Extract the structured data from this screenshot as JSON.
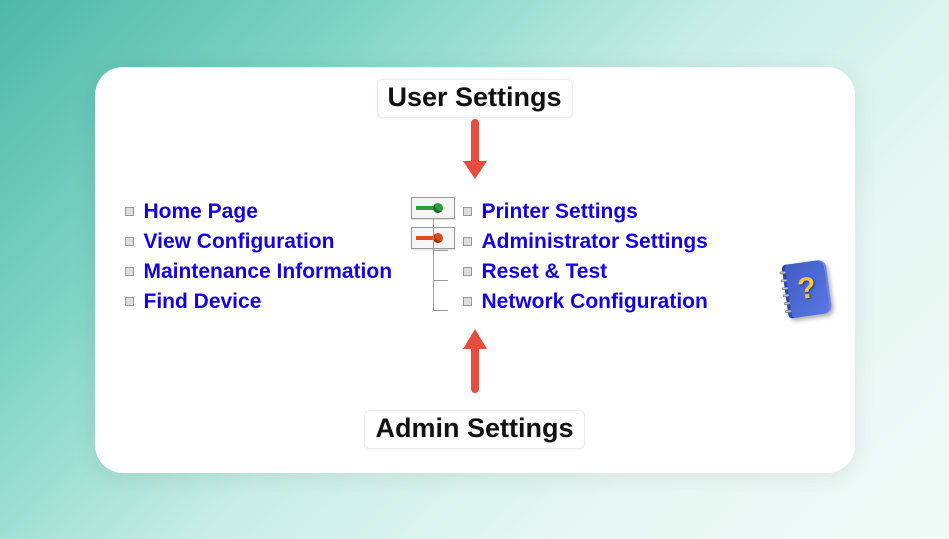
{
  "labels": {
    "user_settings": "User Settings",
    "admin_settings": "Admin Settings"
  },
  "left_links": [
    {
      "label": "Home Page"
    },
    {
      "label": "View Configuration"
    },
    {
      "label": "Maintenance Information"
    },
    {
      "label": "Find Device"
    }
  ],
  "right_links": [
    {
      "label": "Printer Settings"
    },
    {
      "label": "Administrator Settings"
    },
    {
      "label": "Reset & Test"
    },
    {
      "label": "Network Configuration"
    }
  ],
  "keys": {
    "user_key": "user-key-green",
    "admin_key": "admin-key-orange"
  },
  "help": {
    "glyph": "?"
  }
}
